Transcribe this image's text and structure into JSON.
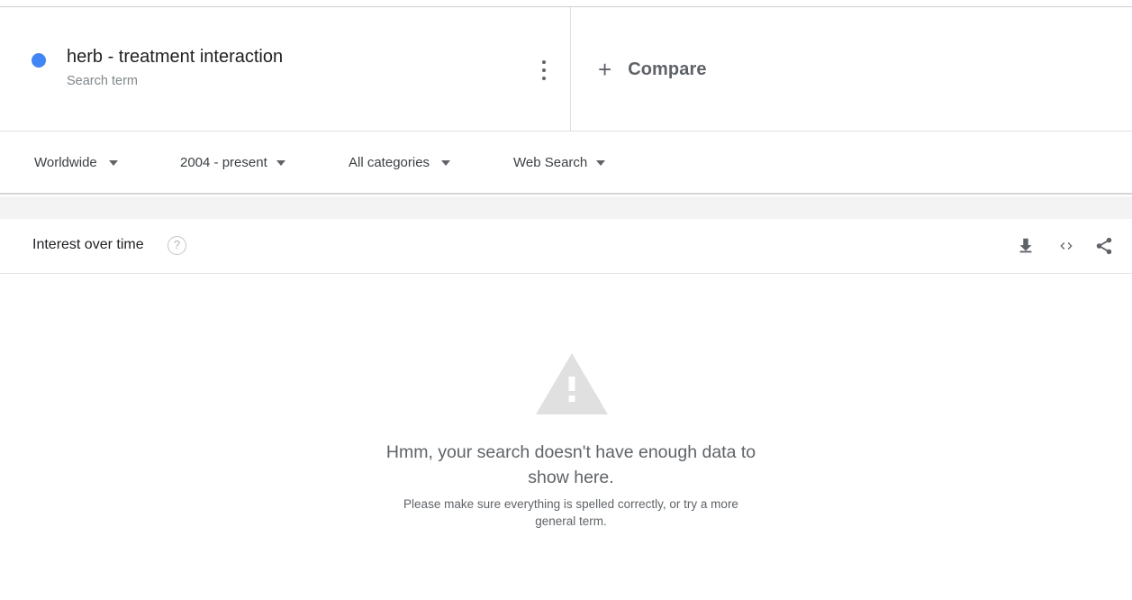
{
  "search_term": {
    "name": "herb - treatment interaction",
    "type": "Search term",
    "color": "#4285f4",
    "menu_icon": "more-vert-icon"
  },
  "compare": {
    "icon": "plus-icon",
    "label": "Compare"
  },
  "filters": {
    "region": "Worldwide",
    "time_range": "2004 - present",
    "category": "All categories",
    "search_type": "Web Search"
  },
  "interest_over_time": {
    "title": "Interest over time",
    "help_icon_glyph": "?",
    "actions": [
      "download-icon",
      "embed-icon",
      "share-icon"
    ]
  },
  "empty_state": {
    "icon": "warning-icon",
    "message": "Hmm, your search doesn't have enough data to show here.",
    "hint": "Please make sure everything is spelled correctly, or try a more general term."
  },
  "colors": {
    "series": "#4285f4",
    "muted_text": "#5f6368",
    "warning_icon": "#e0e0e0"
  }
}
